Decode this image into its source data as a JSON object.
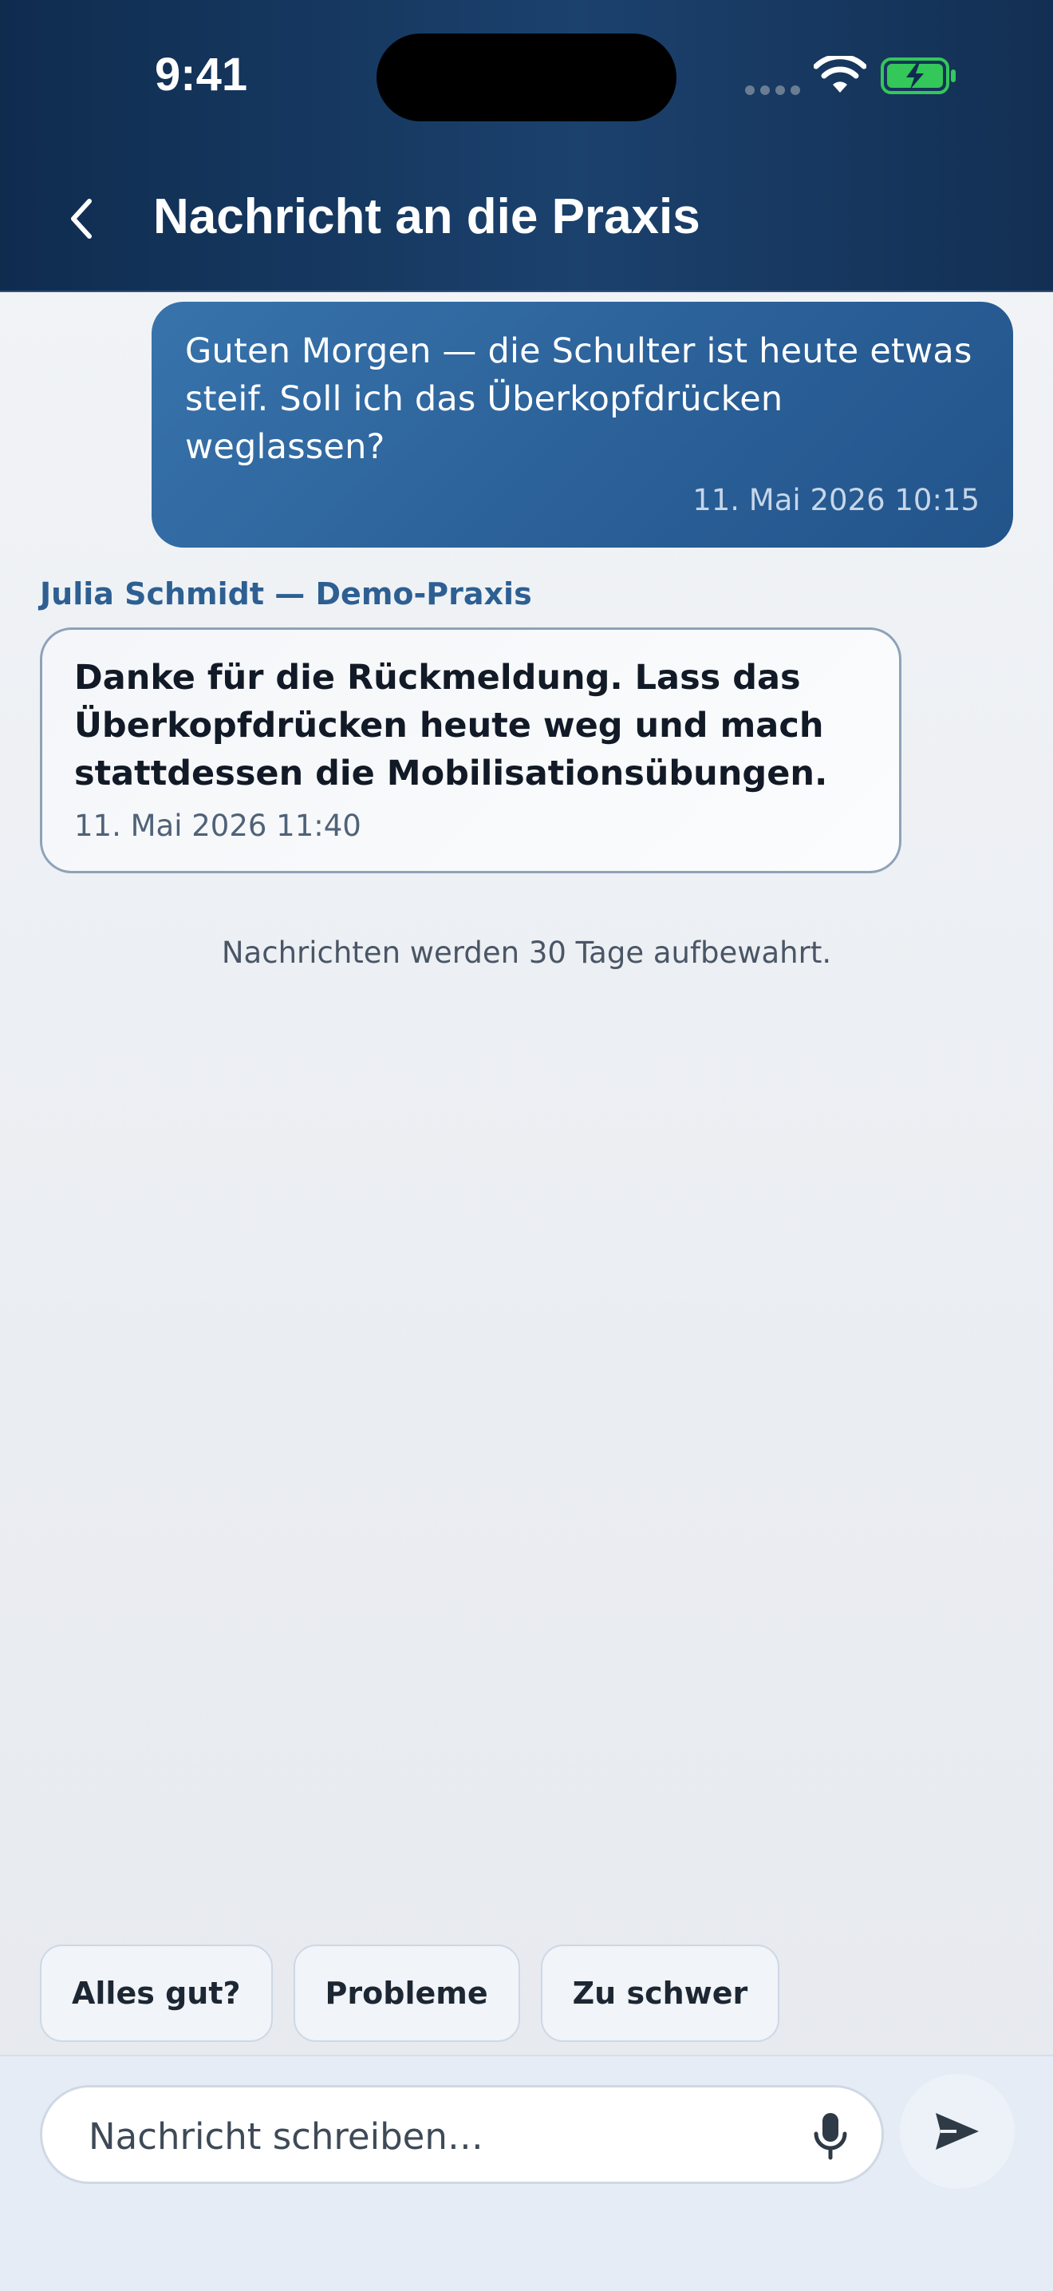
{
  "status_bar": {
    "time": "9:41"
  },
  "header": {
    "title": "Nachricht an die Praxis",
    "back_icon": "chevron-left-icon"
  },
  "messages": [
    {
      "direction": "outgoing",
      "text": "Guten Morgen — die Schulter ist heute etwas steif. Soll ich das Überkopfdrücken weglassen?",
      "timestamp": "11. Mai 2026 10:15"
    },
    {
      "direction": "incoming",
      "sender": "Julia Schmidt — Demo-Praxis",
      "text": "Danke für die Rückmeldung. Lass das Überkopfdrücken heute weg und mach stattdessen die Mobilisationsübungen.",
      "timestamp": "11. Mai 2026 11:40"
    }
  ],
  "retention_note": "Nachrichten werden 30 Tage aufbewahrt.",
  "quick_replies": [
    "Alles gut?",
    "Probleme",
    "Zu schwer"
  ],
  "composer": {
    "placeholder": "Nachricht schreiben…",
    "mic_icon": "microphone-icon",
    "send_icon": "send-icon"
  },
  "colors": {
    "header": "#16365d",
    "outgoing_bubble": "#2f6aa2",
    "accent_text": "#2d5f92",
    "battery": "#34c759"
  }
}
